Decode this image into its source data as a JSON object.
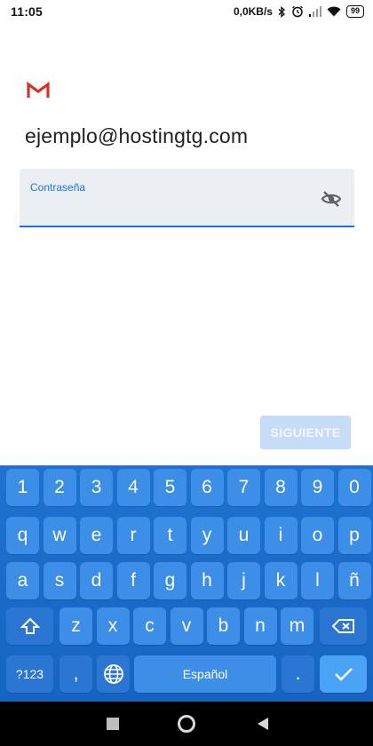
{
  "status": {
    "time": "11:05",
    "speed": "0,0KB/s",
    "battery": "99"
  },
  "account": {
    "email": "ejemplo@hostingtg.com"
  },
  "password": {
    "label": "Contraseña",
    "value": ""
  },
  "next_button": {
    "label": "SIGUIENTE",
    "enabled": false
  },
  "keyboard": {
    "number_row": [
      "1",
      "2",
      "3",
      "4",
      "5",
      "6",
      "7",
      "8",
      "9",
      "0"
    ],
    "row1": [
      "q",
      "w",
      "e",
      "r",
      "t",
      "y",
      "u",
      "i",
      "o",
      "p"
    ],
    "row2": [
      "a",
      "s",
      "d",
      "f",
      "g",
      "h",
      "j",
      "k",
      "l",
      "ñ"
    ],
    "row3": [
      "z",
      "x",
      "c",
      "v",
      "b",
      "n",
      "m"
    ],
    "symbols_key": "?123",
    "comma_key": ",",
    "space_key": "Español",
    "period_key": "."
  },
  "colors": {
    "accent": "#1a73e8",
    "keyboard_bg": "#1565c0",
    "key": "#3d8ee6",
    "gmail_red": "#d93025"
  }
}
